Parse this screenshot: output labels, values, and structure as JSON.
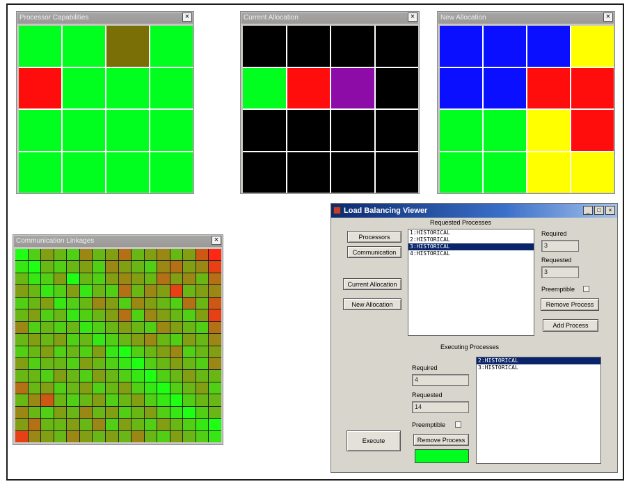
{
  "windows": {
    "processor": {
      "title": "Processor Capabilities",
      "close": "×",
      "cells": [
        "#00ff1e",
        "#00ff1e",
        "#7a6e06",
        "#00ff1e",
        "#ff0c0c",
        "#00ff1e",
        "#00ff1e",
        "#00ff1e",
        "#00ff1e",
        "#00ff1e",
        "#00ff1e",
        "#00ff1e",
        "#00ff1e",
        "#00ff1e",
        "#00ff1e",
        "#00ff1e"
      ]
    },
    "current": {
      "title": "Current Allocation",
      "close": "×",
      "cells": [
        "#000000",
        "#000000",
        "#000000",
        "#000000",
        "#00ff1e",
        "#ff0c0c",
        "#8d0ca8",
        "#000000",
        "#000000",
        "#000000",
        "#000000",
        "#000000",
        "#000000",
        "#000000",
        "#000000",
        "#000000"
      ]
    },
    "newalloc": {
      "title": "New Allocation",
      "close": "×",
      "cells": [
        "#0a10ff",
        "#0a10ff",
        "#0a10ff",
        "#ffff00",
        "#0a10ff",
        "#0a10ff",
        "#ff0c0c",
        "#ff0c0c",
        "#00ff1e",
        "#00ff1e",
        "#ffff00",
        "#ff0c0c",
        "#00ff1e",
        "#00ff1e",
        "#ffff00",
        "#ffff00"
      ]
    },
    "comm": {
      "title": "Communication Linkages",
      "close": "×",
      "size": 16,
      "levels": [
        [
          0,
          2,
          4,
          3,
          2,
          5,
          3,
          4,
          6,
          3,
          4,
          5,
          3,
          4,
          7,
          9
        ],
        [
          1,
          0,
          3,
          2,
          3,
          4,
          2,
          5,
          4,
          3,
          2,
          5,
          6,
          4,
          5,
          8
        ],
        [
          3,
          1,
          2,
          4,
          0,
          3,
          2,
          4,
          5,
          4,
          3,
          6,
          4,
          5,
          3,
          6
        ],
        [
          4,
          3,
          1,
          2,
          4,
          1,
          3,
          2,
          6,
          3,
          5,
          4,
          8,
          3,
          4,
          5
        ],
        [
          2,
          3,
          4,
          1,
          2,
          3,
          5,
          4,
          2,
          5,
          4,
          3,
          2,
          6,
          3,
          7
        ],
        [
          3,
          4,
          2,
          3,
          1,
          2,
          3,
          4,
          6,
          2,
          5,
          4,
          3,
          2,
          4,
          8
        ],
        [
          5,
          2,
          3,
          2,
          3,
          1,
          2,
          3,
          4,
          3,
          2,
          5,
          4,
          3,
          2,
          6
        ],
        [
          3,
          4,
          3,
          4,
          2,
          3,
          1,
          2,
          3,
          4,
          5,
          3,
          2,
          4,
          3,
          5
        ],
        [
          2,
          3,
          4,
          2,
          3,
          2,
          4,
          1,
          0,
          2,
          3,
          4,
          5,
          2,
          3,
          4
        ],
        [
          4,
          2,
          3,
          3,
          2,
          4,
          3,
          2,
          1,
          0,
          2,
          3,
          4,
          3,
          2,
          5
        ],
        [
          3,
          3,
          2,
          4,
          3,
          2,
          4,
          3,
          2,
          1,
          0,
          2,
          3,
          4,
          3,
          3
        ],
        [
          6,
          3,
          4,
          2,
          3,
          4,
          2,
          3,
          4,
          2,
          1,
          0,
          2,
          3,
          4,
          2
        ],
        [
          3,
          5,
          7,
          3,
          2,
          3,
          4,
          2,
          3,
          4,
          2,
          1,
          0,
          2,
          3,
          3
        ],
        [
          5,
          3,
          2,
          4,
          3,
          5,
          3,
          4,
          2,
          3,
          4,
          2,
          1,
          0,
          2,
          3
        ],
        [
          4,
          6,
          3,
          3,
          4,
          3,
          5,
          2,
          4,
          3,
          2,
          4,
          3,
          2,
          1,
          0
        ],
        [
          8,
          5,
          4,
          3,
          5,
          4,
          3,
          4,
          3,
          5,
          3,
          2,
          4,
          3,
          2,
          1
        ]
      ]
    }
  },
  "lbv": {
    "title": "Load Balancing Viewer",
    "min": "_",
    "max": "□",
    "close": "×",
    "requested_header": "Requested Processes",
    "executing_header": "Executing Processes",
    "buttons": {
      "processors": "Processors",
      "communication": "Communication",
      "current_allocation": "Current Allocation",
      "new_allocation": "New Allocation",
      "remove_process_top": "Remove Process",
      "add_process": "Add Process",
      "execute": "Execute",
      "remove_process_bottom": "Remove Process"
    },
    "requested_list": [
      "1:HISTORICAL",
      "2:HISTORICAL",
      "3:HISTORICAL",
      "4:HISTORICAL"
    ],
    "requested_selected": 2,
    "top_fields": {
      "required_label": "Required",
      "required_value": "3",
      "requested_label": "Requested",
      "requested_value": "3",
      "preemptible_label": "Preemptible"
    },
    "bottom_fields": {
      "required_label": "Required",
      "required_value": "4",
      "requested_label": "Requested",
      "requested_value": "14",
      "preemptible_label": "Preemptible"
    },
    "executing_list": [
      "2:HISTORICAL",
      "3:HISTORICAL"
    ],
    "executing_selected": 0,
    "status_color": "#00ff1e"
  }
}
